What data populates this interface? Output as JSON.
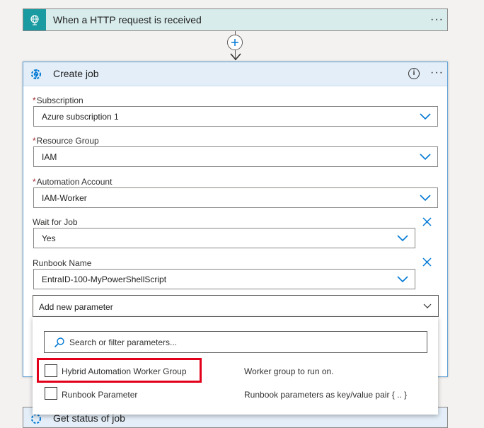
{
  "trigger": {
    "title": "When a HTTP request is received",
    "icon": "globe-icon",
    "more": "···"
  },
  "action": {
    "title": "Create job",
    "icon": "automation-gear-icon",
    "info": "i",
    "more": "···",
    "fields": {
      "subscription": {
        "label": "Subscription",
        "required": "*",
        "value": "Azure subscription 1"
      },
      "resource_group": {
        "label": "Resource Group",
        "required": "*",
        "value": "IAM"
      },
      "automation_account": {
        "label": "Automation Account",
        "required": "*",
        "value": "IAM-Worker"
      },
      "wait_for_job": {
        "label": "Wait for Job",
        "value": "Yes"
      },
      "runbook_name": {
        "label": "Runbook Name",
        "value": "EntraID-100-MyPowerShellScript"
      }
    },
    "add_param": {
      "label": "Add new parameter"
    }
  },
  "param_picker": {
    "search_placeholder": "Search or filter parameters...",
    "options": [
      {
        "label": "Hybrid Automation Worker Group",
        "description": "Worker group to run on.",
        "checked": false
      },
      {
        "label": "Runbook Parameter",
        "description": "Runbook parameters as key/value pair { .. }",
        "checked": false
      }
    ]
  },
  "next_step": {
    "title": "Get status of job"
  },
  "colors": {
    "accent": "#0078d4",
    "trigger": "#1a9ba1",
    "highlight": "#e3001b",
    "required": "#a4262c"
  }
}
